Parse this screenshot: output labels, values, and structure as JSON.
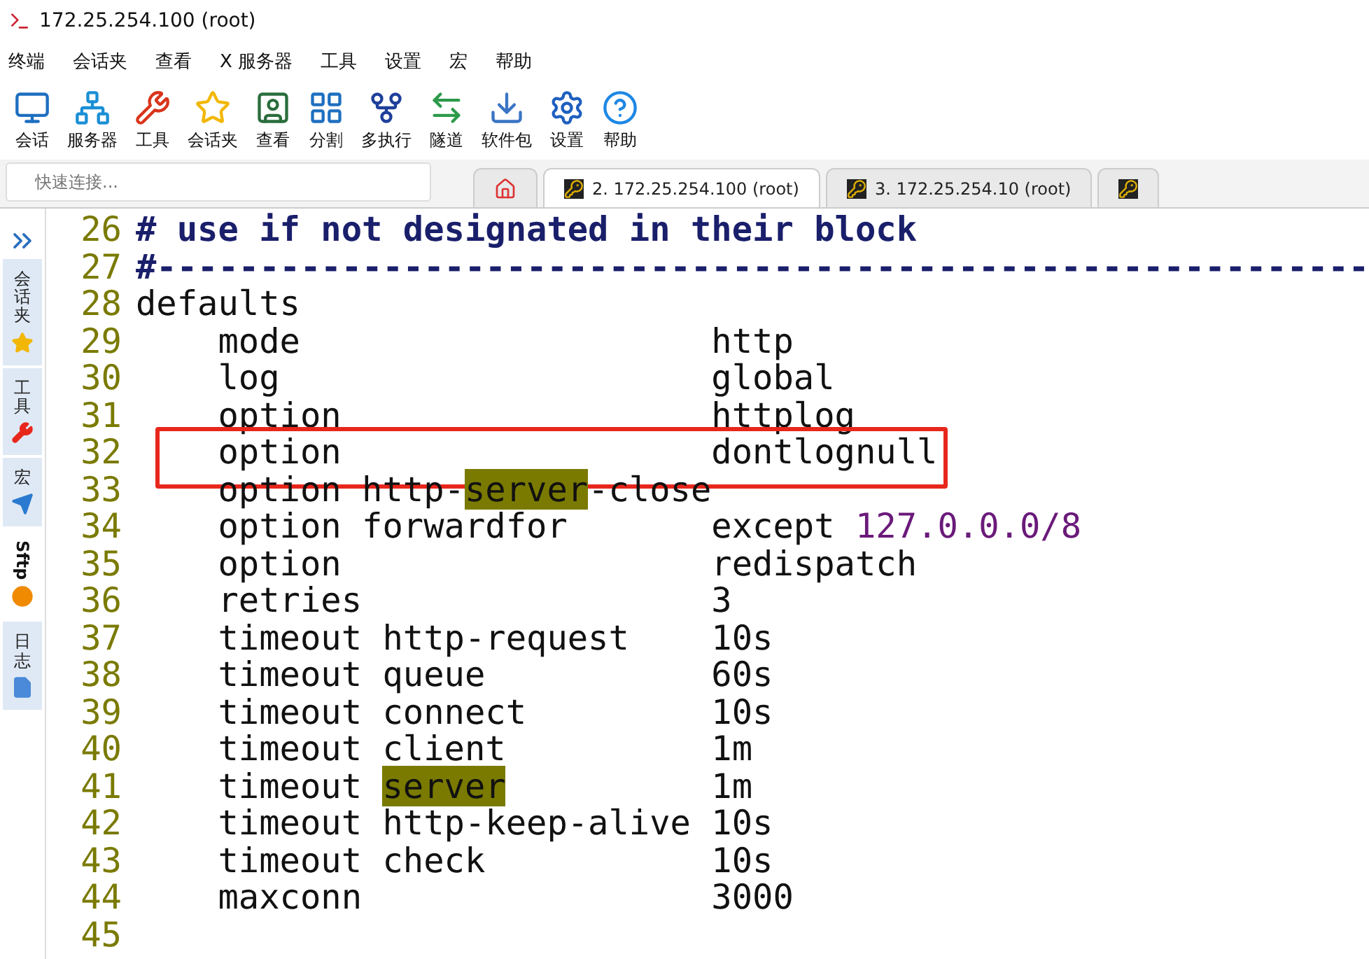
{
  "window": {
    "title": "172.25.254.100 (root)"
  },
  "menu": [
    "终端",
    "会话夹",
    "查看",
    "X 服务器",
    "工具",
    "设置",
    "宏",
    "帮助"
  ],
  "toolbar": [
    {
      "kind": "session",
      "label": "会话"
    },
    {
      "kind": "servers",
      "label": "服务器"
    },
    {
      "kind": "tools",
      "label": "工具"
    },
    {
      "kind": "favorites",
      "label": "会话夹"
    },
    {
      "kind": "view",
      "label": "查看"
    },
    {
      "kind": "split",
      "label": "分割"
    },
    {
      "kind": "multiexec",
      "label": "多执行"
    },
    {
      "kind": "tunnel",
      "label": "隧道"
    },
    {
      "kind": "packages",
      "label": "软件包"
    },
    {
      "kind": "settings",
      "label": "设置"
    },
    {
      "kind": "help",
      "label": "帮助"
    }
  ],
  "quick_connect": {
    "placeholder": "快速连接..."
  },
  "tabs": [
    {
      "kind": "home",
      "selected": false
    },
    {
      "kind": "terminal",
      "label": "2. 172.25.254.100 (root)",
      "selected": true
    },
    {
      "kind": "terminal",
      "label": "3. 172.25.254.10 (root)",
      "selected": false
    },
    {
      "kind": "terminal",
      "selected": false
    }
  ],
  "side_tabs": [
    {
      "kind": "chars",
      "label": "会话夹",
      "selected": false
    },
    {
      "kind": "chars",
      "label": "工具",
      "selected": false
    },
    {
      "kind": "chars",
      "label": "宏",
      "selected": false
    },
    {
      "kind": "latin",
      "label": "Sftp",
      "selected": true
    },
    {
      "kind": "chars",
      "label": "日志",
      "selected": false
    }
  ],
  "lines": [
    {
      "number": "26",
      "parts": [
        {
          "kind": "comment",
          "text": "# use if not designated in their block"
        }
      ]
    },
    {
      "number": "27",
      "parts": [
        {
          "kind": "comment",
          "text": "#-----------------------------------------------------------"
        }
      ]
    },
    {
      "number": "28",
      "parts": [
        {
          "kind": "plain",
          "text": "defaults"
        }
      ]
    },
    {
      "number": "29",
      "parts": [
        {
          "kind": "plain",
          "text": "    mode                    http"
        }
      ]
    },
    {
      "number": "30",
      "parts": [
        {
          "kind": "plain",
          "text": "    log                     global"
        }
      ]
    },
    {
      "number": "31",
      "parts": [
        {
          "kind": "plain",
          "text": "    option                  httplog"
        }
      ]
    },
    {
      "number": "32",
      "boxed": true,
      "parts": [
        {
          "kind": "plain",
          "text": "    option                  dontlognull"
        }
      ]
    },
    {
      "number": "33",
      "parts": [
        {
          "kind": "plain",
          "text": "    option http-"
        },
        {
          "kind": "match",
          "text": "server"
        },
        {
          "kind": "plain",
          "text": "-close"
        }
      ]
    },
    {
      "number": "34",
      "parts": [
        {
          "kind": "plain",
          "text": "    option forwardfor       except "
        },
        {
          "kind": "number",
          "text": "127.0.0.0/8"
        }
      ]
    },
    {
      "number": "35",
      "parts": [
        {
          "kind": "plain",
          "text": "    option                  redispatch"
        }
      ]
    },
    {
      "number": "36",
      "parts": [
        {
          "kind": "plain",
          "text": "    retries                 3"
        }
      ]
    },
    {
      "number": "37",
      "parts": [
        {
          "kind": "plain",
          "text": "    timeout http-request    10s"
        }
      ]
    },
    {
      "number": "38",
      "parts": [
        {
          "kind": "plain",
          "text": "    timeout queue           60s"
        }
      ]
    },
    {
      "number": "39",
      "parts": [
        {
          "kind": "plain",
          "text": "    timeout connect         10s"
        }
      ]
    },
    {
      "number": "40",
      "parts": [
        {
          "kind": "plain",
          "text": "    timeout client          1m"
        }
      ]
    },
    {
      "number": "41",
      "parts": [
        {
          "kind": "plain",
          "text": "    timeout "
        },
        {
          "kind": "match",
          "text": "server"
        },
        {
          "kind": "plain",
          "text": "          1m"
        }
      ]
    },
    {
      "number": "42",
      "parts": [
        {
          "kind": "plain",
          "text": "    timeout http-keep-alive 10s"
        }
      ]
    },
    {
      "number": "43",
      "parts": [
        {
          "kind": "plain",
          "text": "    timeout check           10s"
        }
      ]
    },
    {
      "number": "44",
      "parts": [
        {
          "kind": "plain",
          "text": "    maxconn                 3000"
        }
      ]
    },
    {
      "number": "45"
    }
  ]
}
